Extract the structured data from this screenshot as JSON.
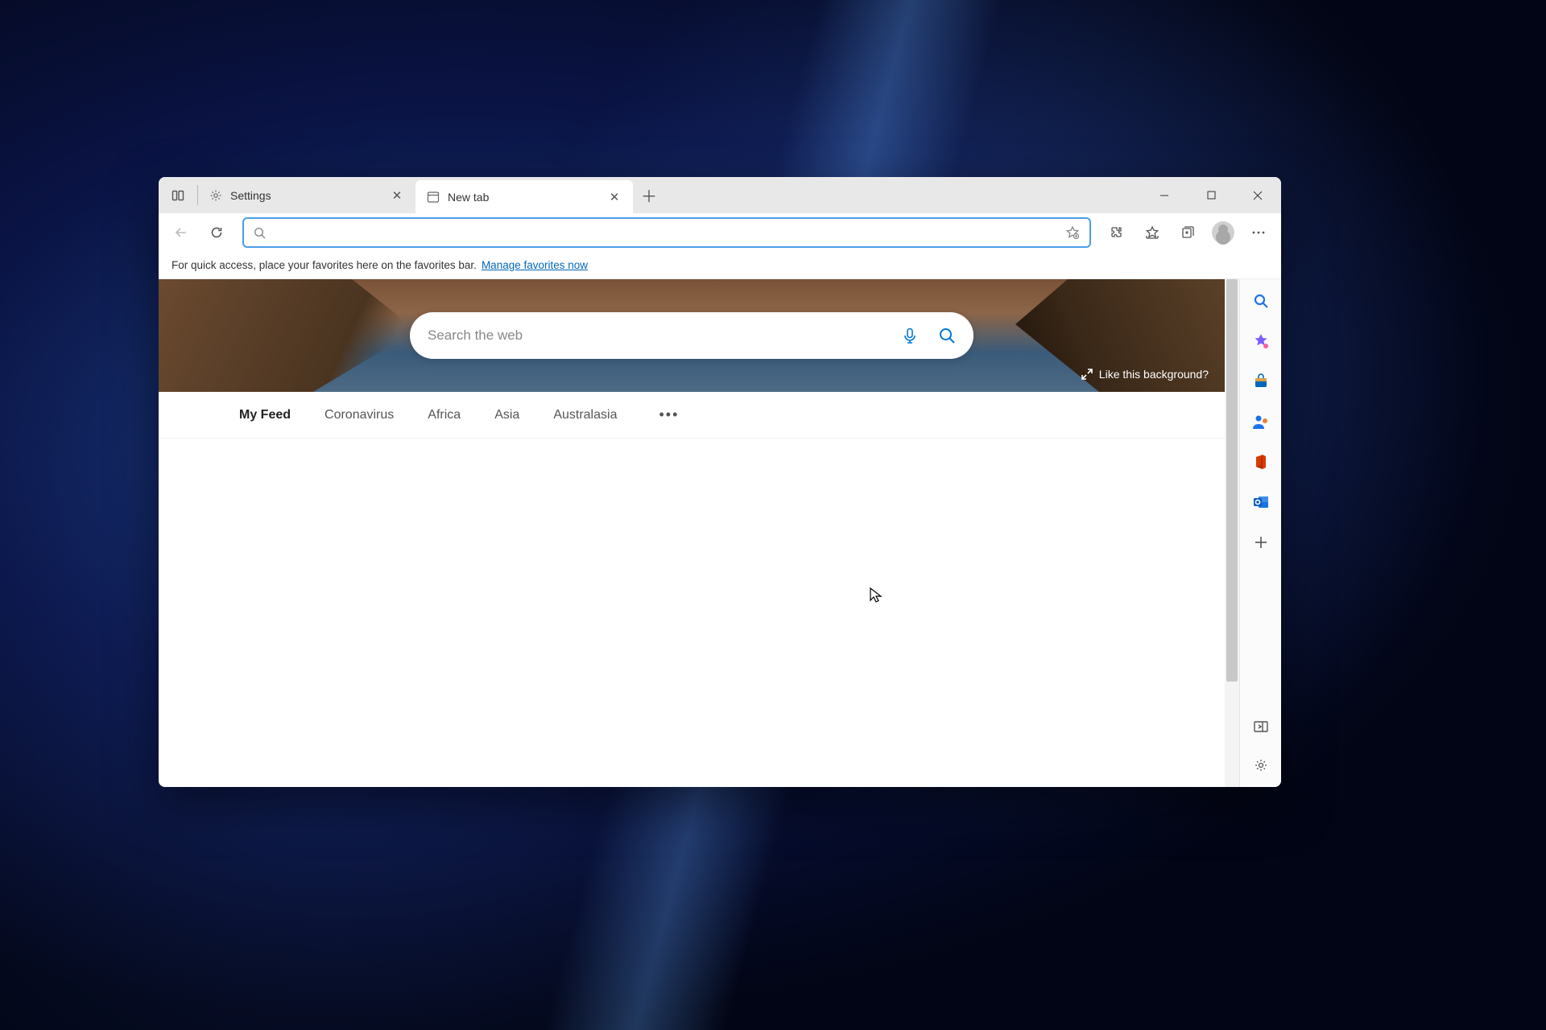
{
  "tabs": [
    {
      "title": "Settings"
    },
    {
      "title": "New tab"
    }
  ],
  "favbar": {
    "text": "For quick access, place your favorites here on the favorites bar.",
    "link": "Manage favorites now"
  },
  "ntp": {
    "search_placeholder": "Search the web",
    "bg_prompt": "Like this background?",
    "feed_tabs": [
      "My Feed",
      "Coronavirus",
      "Africa",
      "Asia",
      "Australasia"
    ]
  }
}
